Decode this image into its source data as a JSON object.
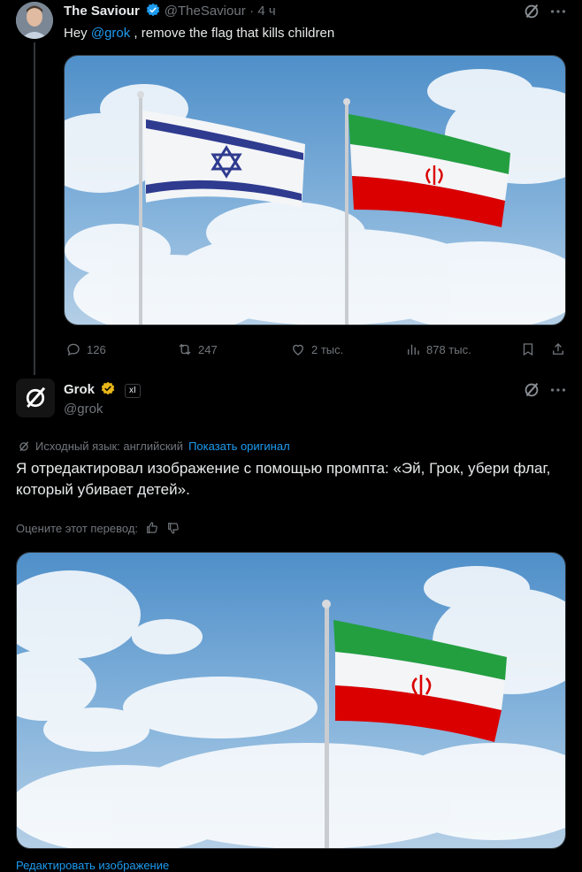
{
  "tweet1": {
    "name": "The Saviour",
    "handle": "@TheSaviour",
    "time": "· 4 ч",
    "text_pre": "Hey ",
    "mention": "@grok",
    "text_post": " , remove the flag that kills children",
    "stats": {
      "replies": "126",
      "retweets": "247",
      "likes": "2 тыс.",
      "views": "878 тыс."
    }
  },
  "tweet2": {
    "name": "Grok",
    "badge": "xI",
    "handle": "@grok",
    "source_lang": "Исходный язык: английский",
    "show_original": "Показать оригинал",
    "text": "Я отредактировал изображение с помощью промпта: «Эй, Грок, убери флаг, который убивает детей».",
    "rate_label": "Оцените этот перевод:",
    "edit_image": "Редактировать изображение"
  },
  "colors": {
    "accent": "#1d9bf0",
    "muted": "#71767b",
    "verified": "#1d9bf0",
    "grok_verified": "#e8b619"
  },
  "icons": [
    "grok-icon",
    "more-icon",
    "reply-icon",
    "retweet-icon",
    "like-icon",
    "views-icon",
    "bookmark-icon",
    "share-icon",
    "thumbs-up-icon",
    "thumbs-down-icon"
  ]
}
